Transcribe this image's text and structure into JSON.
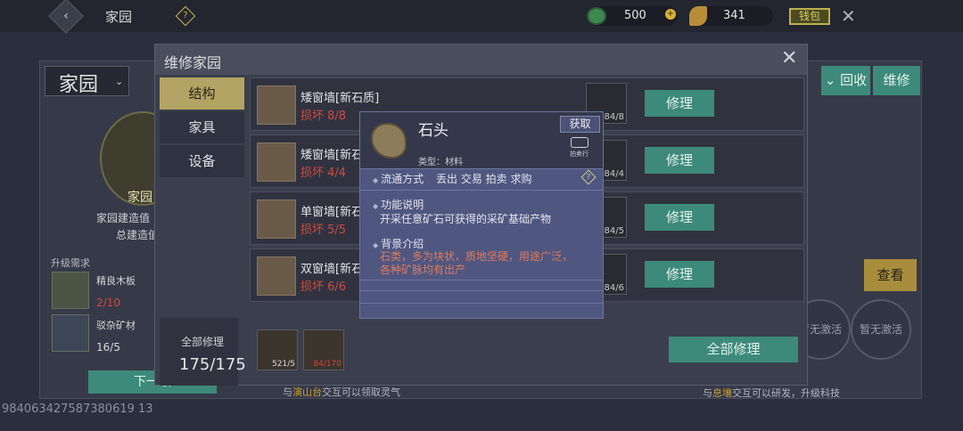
{
  "topbar": {
    "title": "家园",
    "currency1": "500",
    "currency2": "341",
    "wallet_label": "钱包"
  },
  "background": {
    "page_title": "家园",
    "emblem_label": "家园",
    "build_value_label": "家园建造值",
    "total_build_label": "总建造值",
    "upgrade_label": "升级需求",
    "materials": [
      {
        "name": "精良木板",
        "count": "2/10",
        "color": "#d2463f"
      },
      {
        "name": "驳杂矿材",
        "count": "16/5",
        "color": "#d8d8d8"
      }
    ],
    "next_btn": "下一级",
    "recycle_btn": "回收",
    "repair_btn": "维修",
    "view_btn": "查看",
    "inactive1": "暂无激活",
    "inactive2": "暂无激活",
    "note_right_pre": "与",
    "note_right_hl": "息壤",
    "note_right_post": "交互可以研发，升级科技",
    "uid": "984063427587380619 13"
  },
  "dialog": {
    "title": "维修家园",
    "tabs": [
      "结构",
      "家具",
      "设备"
    ],
    "rows": [
      {
        "name": "矮窗墙[新石质]",
        "damage": "损坏 8/8",
        "mat_count": "84/8",
        "btn": "修理"
      },
      {
        "name": "矮窗墙[新石质]",
        "damage": "损坏 4/4",
        "mat_count": "84/4",
        "btn": "修理"
      },
      {
        "name": "单窗墙[新石",
        "damage": "损坏 5/5",
        "mat_count": "84/5",
        "btn": "修理"
      },
      {
        "name": "双窗墙[新石",
        "damage": "损坏 6/6",
        "mat_count": "84/6",
        "btn": "修理"
      }
    ],
    "summary_label": "全部修理",
    "summary_value": "175/175",
    "bottom_mats": [
      {
        "count": "521/5",
        "color": "#dcdcdc"
      },
      {
        "count": "84/170",
        "color": "#d2463f"
      }
    ],
    "repair_all": "全部修理",
    "note_left_pre": "与",
    "note_left_hl": "演山台",
    "note_left_post": "交互可以领取灵气"
  },
  "tooltip": {
    "name": "石头",
    "type": "类型：材料",
    "get_btn": "获取",
    "cart_label": "拍卖行",
    "circulation_label": "流通方式",
    "circulation_value": "丢出 交易 拍卖 求购",
    "function_label": "功能说明",
    "function_text": "开采任意矿石可获得的采矿基础产物",
    "background_label": "背景介绍",
    "background_line1": "石类，多为块状，质地坚硬，用途广泛，",
    "background_line2": "各种矿脉均有出产"
  }
}
